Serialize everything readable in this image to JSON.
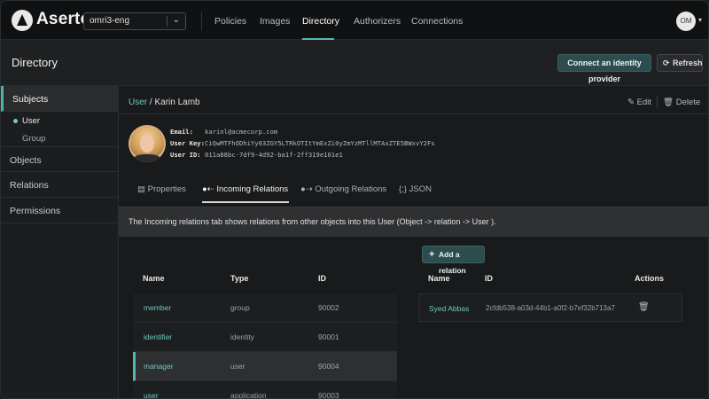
{
  "app": {
    "brand": "Aserto",
    "tenant": "omri3-eng"
  },
  "nav": {
    "items": [
      "Policies",
      "Images",
      "Directory",
      "Authorizers",
      "Connections"
    ],
    "active": "Directory"
  },
  "user_menu": {
    "initials": "OM"
  },
  "header": {
    "title": "Directory",
    "connect_label": "Connect an identity provider",
    "refresh_label": "Refresh"
  },
  "sidebar": {
    "items": [
      "Subjects",
      "Objects",
      "Relations",
      "Permissions"
    ],
    "subjects_sub": [
      "User",
      "Group"
    ]
  },
  "breadcrumb": {
    "parent": "User",
    "sep": " / ",
    "current": "Karin Lamb"
  },
  "actions": {
    "edit": "Edit",
    "delete": "Delete"
  },
  "profile": {
    "email_label": "Email:",
    "email": "karinl@acmecorp.com",
    "key_label": "User Key:",
    "key": "CiQwMTFhODhiYy03ZGY5LTRkOTItYmExZi0yZmYzMTllMTAxZTE5BWxvY2Fs",
    "id_label": "User ID:",
    "id": "011a88bc-7df9-4d92-ba1f-2ff319e101e1"
  },
  "tabs": [
    "Properties",
    "Incoming Relations",
    "Outgoing Relations",
    "JSON"
  ],
  "info_text": "The Incoming relations tab shows relations from other objects into this User (Object -> relation -> User ).",
  "add_relation_label": "Add a relation",
  "left_table": {
    "headers": [
      "Name",
      "Type",
      "ID"
    ],
    "rows": [
      {
        "name": "member",
        "type": "group",
        "id": "90002"
      },
      {
        "name": "identifier",
        "type": "identity",
        "id": "90001"
      },
      {
        "name": "manager",
        "type": "user",
        "id": "90004"
      },
      {
        "name": "user",
        "type": "application",
        "id": "90003"
      }
    ]
  },
  "right_table": {
    "headers": [
      "Name",
      "ID",
      "Actions"
    ],
    "rows": [
      {
        "name": "Syed Abbas",
        "id": "2cfdb538-a03d-44b1-a0f2-b7ef32b713a7"
      }
    ]
  },
  "colors": {
    "accent": "#56b8b0",
    "link": "#6ccac2",
    "bg": "#191a1b",
    "button": "#2d4c4f"
  }
}
